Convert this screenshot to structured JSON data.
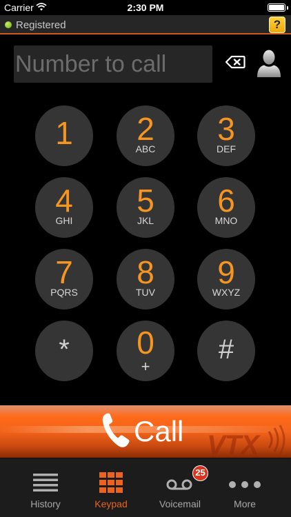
{
  "status_bar": {
    "carrier": "Carrier",
    "time": "2:30 PM"
  },
  "registration": {
    "status": "Registered",
    "help_label": "?",
    "status_color": "#8cc63f"
  },
  "dialer": {
    "placeholder": "Number to call"
  },
  "keypad": {
    "keys": [
      {
        "digit": "1",
        "letters": ""
      },
      {
        "digit": "2",
        "letters": "ABC"
      },
      {
        "digit": "3",
        "letters": "DEF"
      },
      {
        "digit": "4",
        "letters": "GHI"
      },
      {
        "digit": "5",
        "letters": "JKL"
      },
      {
        "digit": "6",
        "letters": "MNO"
      },
      {
        "digit": "7",
        "letters": "PQRS"
      },
      {
        "digit": "8",
        "letters": "TUV"
      },
      {
        "digit": "9",
        "letters": "WXYZ"
      },
      {
        "digit": "*",
        "letters": ""
      },
      {
        "digit": "0",
        "letters": "+"
      },
      {
        "digit": "#",
        "letters": ""
      }
    ]
  },
  "call_button": {
    "label": "Call",
    "watermark": "VTX"
  },
  "tabs": [
    {
      "label": "History",
      "icon": "list-icon",
      "active": false
    },
    {
      "label": "Keypad",
      "icon": "keypad-grid-icon",
      "active": true
    },
    {
      "label": "Voicemail",
      "icon": "voicemail-icon",
      "active": false,
      "badge": "25"
    },
    {
      "label": "More",
      "icon": "more-dots-icon",
      "active": false
    }
  ],
  "colors": {
    "accent": "#f59622",
    "active_tab": "#ea6321",
    "badge": "#d8331c",
    "call_bar": "#f2631a"
  }
}
